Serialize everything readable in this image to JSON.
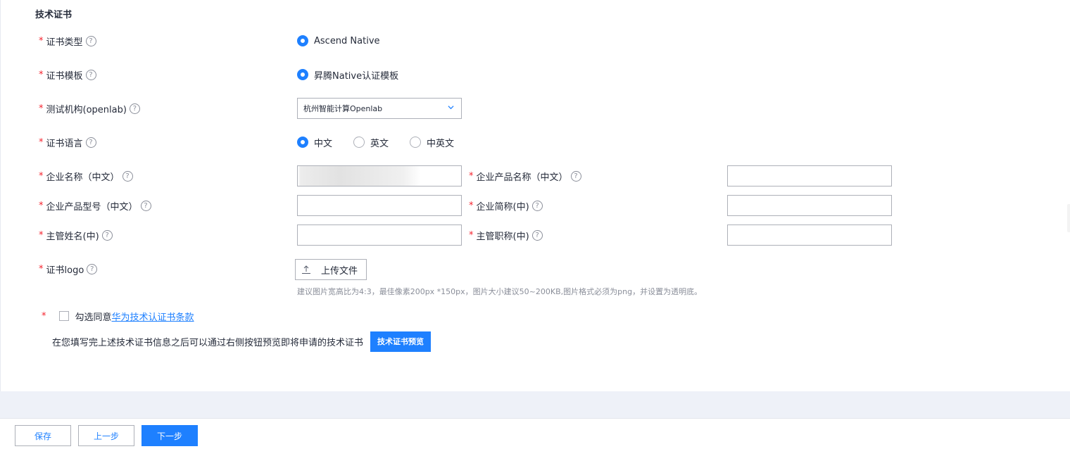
{
  "section": {
    "title": "技术证书"
  },
  "fields": {
    "cert_type": {
      "label": "证书类型",
      "options": [
        "Ascend Native"
      ],
      "selected": "Ascend Native"
    },
    "cert_template": {
      "label": "证书模板",
      "options": [
        "昇腾Native认证模板"
      ],
      "selected": "昇腾Native认证模板"
    },
    "test_org": {
      "label": "测试机构(openlab)",
      "value": "杭州智能计算Openlab"
    },
    "cert_lang": {
      "label": "证书语言",
      "options": [
        "中文",
        "英文",
        "中英文"
      ],
      "selected": "中文"
    },
    "company_name_cn": {
      "label": "企业名称（中文）",
      "value": ""
    },
    "product_name_cn": {
      "label": "企业产品名称（中文）",
      "value": ""
    },
    "product_model_cn": {
      "label": "企业产品型号（中文）",
      "value": ""
    },
    "company_short": {
      "label": "企业简称(中)",
      "value": ""
    },
    "manager_name": {
      "label": "主管姓名(中)",
      "value": ""
    },
    "manager_title": {
      "label": "主管职称(中)",
      "value": ""
    },
    "cert_logo": {
      "label": "证书logo",
      "upload_label": "上传文件",
      "hint": "建议图片宽高比为4:3，最佳像素200px *150px，图片大小建议50~200KB,图片格式必须为png，并设置为透明底。"
    }
  },
  "agreement": {
    "prefix": "勾选同意",
    "link": "华为技术认证书条款",
    "checked": false
  },
  "preview": {
    "text": "在您填写完上述技术证书信息之后可以通过右侧按钮预览即将申请的技术证书",
    "button": "技术证书预览"
  },
  "footer": {
    "save": "保存",
    "prev": "上一步",
    "next": "下一步"
  },
  "common": {
    "required_mark": "*",
    "help_glyph": "?"
  },
  "colors": {
    "primary": "#1e80ff",
    "required": "#f5222d",
    "border": "#adb0b8",
    "band": "#eef1f8"
  }
}
